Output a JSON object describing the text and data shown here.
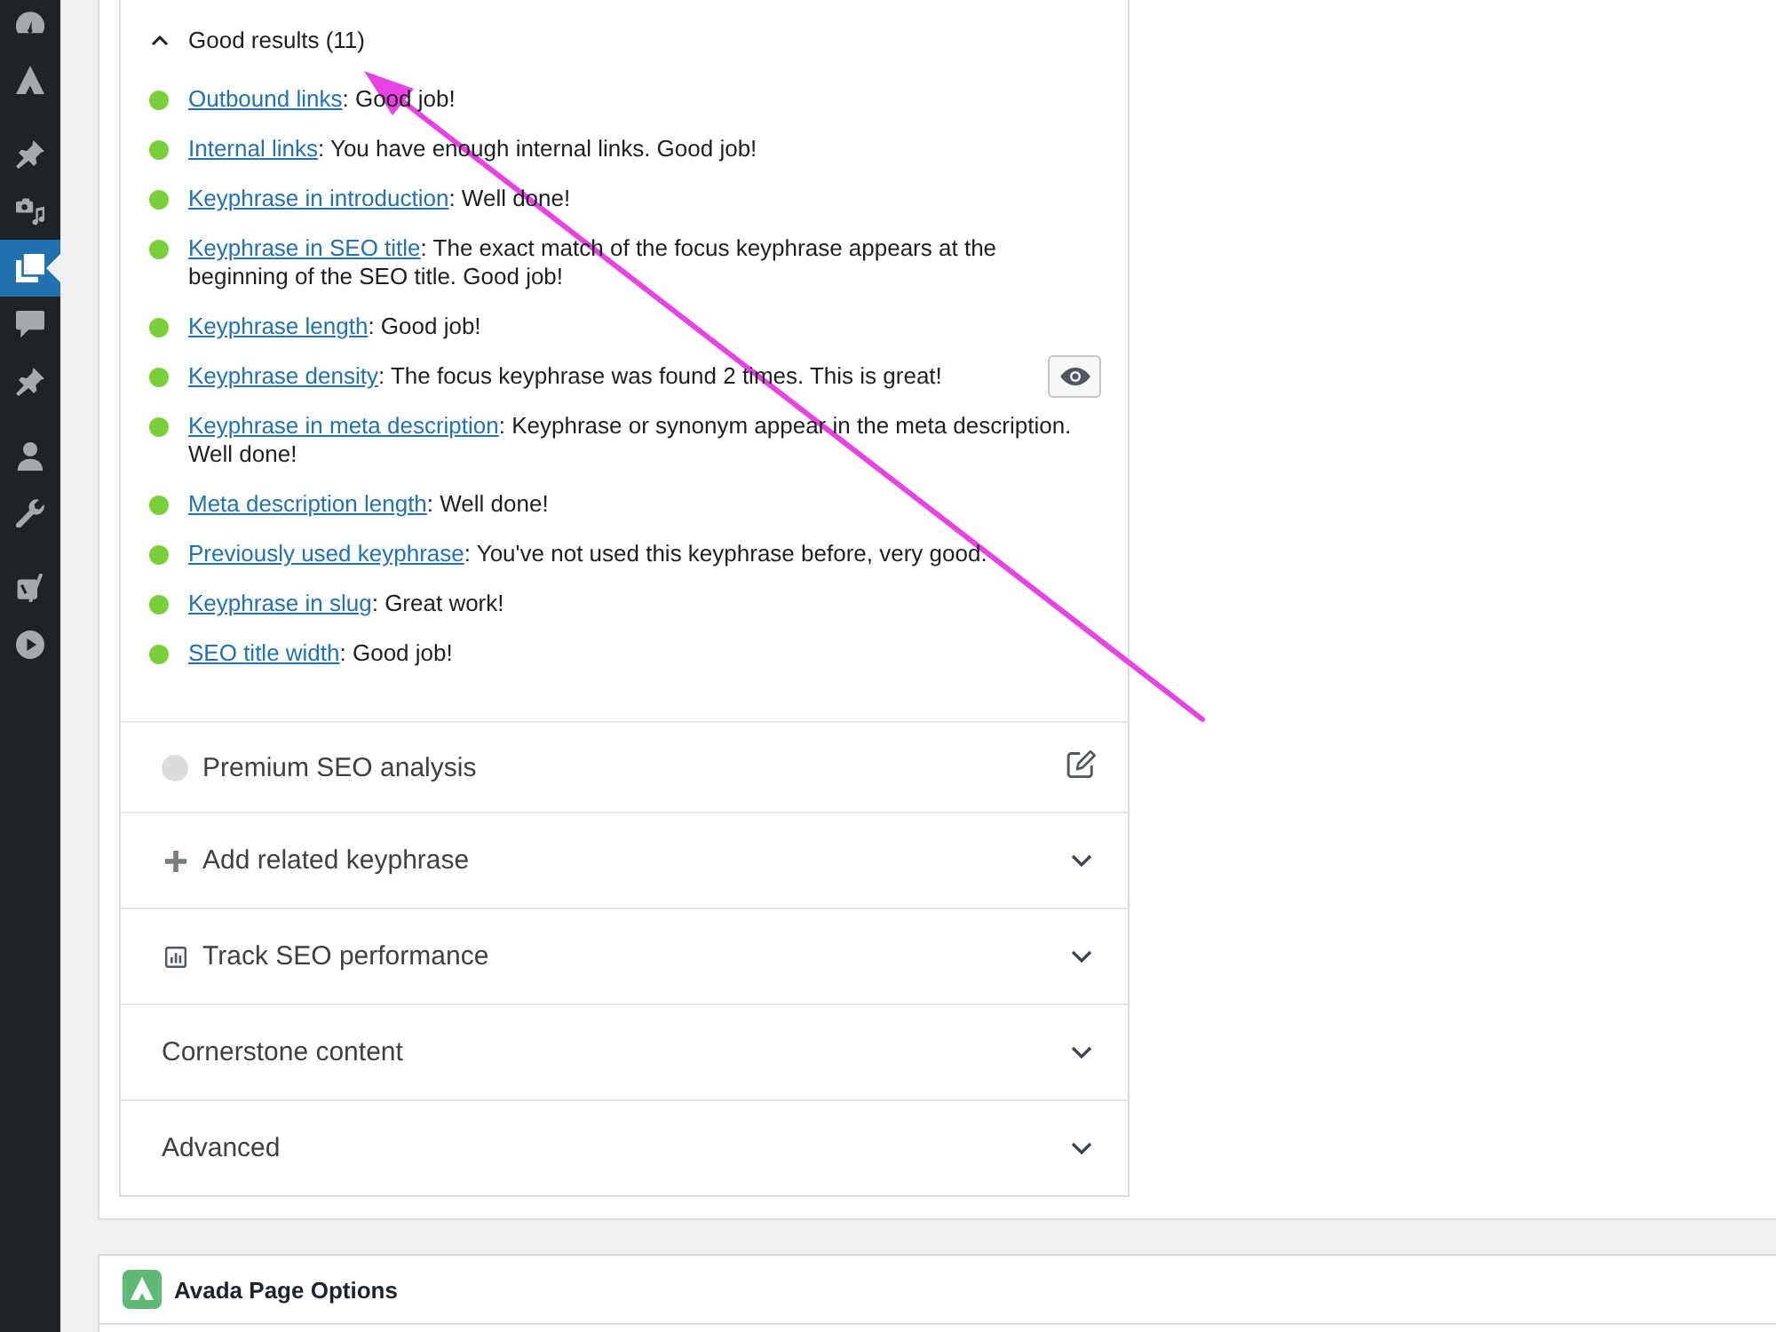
{
  "admin_menu": {
    "groups": [
      {
        "items": [
          {
            "kind": "dashboard",
            "selected": false
          },
          {
            "kind": "avada",
            "selected": false
          }
        ]
      },
      {
        "items": [
          {
            "kind": "pin",
            "selected": false
          },
          {
            "kind": "media",
            "selected": false
          },
          {
            "kind": "pages",
            "selected": true
          },
          {
            "kind": "comments",
            "selected": false
          },
          {
            "kind": "pin",
            "selected": false
          }
        ]
      },
      {
        "items": [
          {
            "kind": "users",
            "selected": false
          },
          {
            "kind": "tools",
            "selected": false
          }
        ]
      },
      {
        "items": [
          {
            "kind": "yoast",
            "selected": false
          },
          {
            "kind": "play",
            "selected": false
          }
        ]
      }
    ]
  },
  "seo_analysis": {
    "good_results": {
      "title": "Good results (11)",
      "expanded": true,
      "items": [
        {
          "link": "Outbound links",
          "text": ": Good job!",
          "eye_button": false
        },
        {
          "link": "Internal links",
          "text": ": You have enough internal links. Good job!",
          "eye_button": false
        },
        {
          "link": "Keyphrase in introduction",
          "text": ": Well done!",
          "eye_button": false
        },
        {
          "link": "Keyphrase in SEO title",
          "text": ": The exact match of the focus keyphrase appears at the beginning of the SEO title. Good job!",
          "eye_button": false
        },
        {
          "link": "Keyphrase length",
          "text": ": Good job!",
          "eye_button": false
        },
        {
          "link": "Keyphrase density",
          "text": ": The focus keyphrase was found 2 times. This is great!",
          "eye_button": true
        },
        {
          "link": "Keyphrase in meta description",
          "text": ": Keyphrase or synonym appear in the meta description. Well done!",
          "eye_button": false
        },
        {
          "link": "Meta description length",
          "text": ": Well done!",
          "eye_button": false
        },
        {
          "link": "Previously used keyphrase",
          "text": ": You've not used this keyphrase before, very good.",
          "eye_button": false
        },
        {
          "link": "Keyphrase in slug",
          "text": ": Great work!",
          "eye_button": false
        },
        {
          "link": "SEO title width",
          "text": ": Good job!",
          "eye_button": false
        }
      ]
    },
    "sections": [
      {
        "kind": "premium",
        "title": "Premium SEO analysis",
        "expanded": false
      },
      {
        "kind": "related",
        "title": "Add related keyphrase",
        "expanded": false
      },
      {
        "kind": "track",
        "title": "Track SEO performance",
        "expanded": false
      },
      {
        "kind": "plain",
        "title": "Cornerstone content",
        "expanded": false
      },
      {
        "kind": "plain",
        "title": "Advanced",
        "expanded": false
      }
    ]
  },
  "avada_page_options": {
    "title": "Avada Page Options"
  },
  "annotation": {
    "kind": "arrow"
  }
}
